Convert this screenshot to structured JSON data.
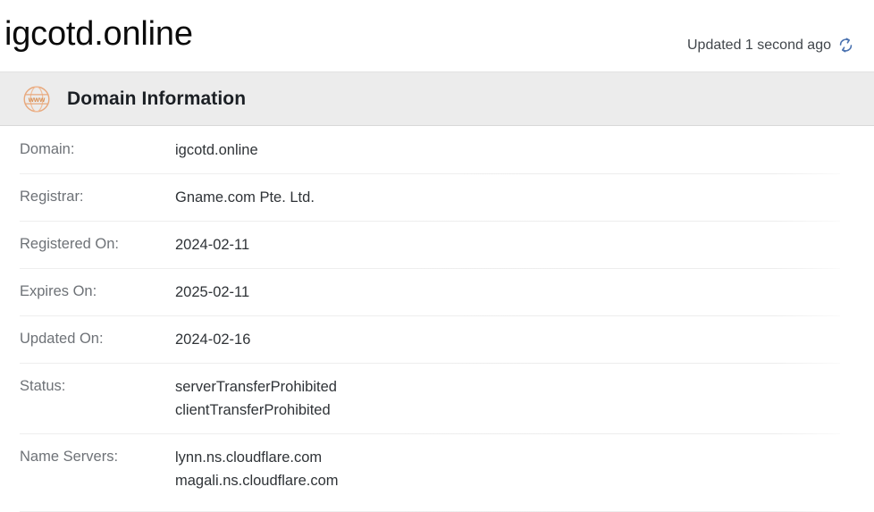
{
  "header": {
    "title": "igcotd.online",
    "updated_text": "Updated 1 second ago",
    "refresh_icon": "refresh-sync-icon"
  },
  "section": {
    "icon": "www-globe-icon",
    "icon_label": "www",
    "title": "Domain Information"
  },
  "colors": {
    "band_background": "#ececec",
    "accent_icon": "#e8a87c",
    "refresh_icon": "#4a72b0",
    "label_text": "#6e7277",
    "value_text": "#2f3337",
    "page_background": "#ffffff",
    "divider": "#ededed"
  },
  "domain_information": {
    "rows": [
      {
        "label": "Domain:",
        "values": [
          "igcotd.online"
        ]
      },
      {
        "label": "Registrar:",
        "values": [
          "Gname.com Pte. Ltd."
        ]
      },
      {
        "label": "Registered On:",
        "values": [
          "2024-02-11"
        ]
      },
      {
        "label": "Expires On:",
        "values": [
          "2025-02-11"
        ]
      },
      {
        "label": "Updated On:",
        "values": [
          "2024-02-16"
        ]
      },
      {
        "label": "Status:",
        "values": [
          "serverTransferProhibited",
          "clientTransferProhibited"
        ]
      },
      {
        "label": "Name Servers:",
        "values": [
          "lynn.ns.cloudflare.com",
          "magali.ns.cloudflare.com"
        ]
      }
    ]
  }
}
